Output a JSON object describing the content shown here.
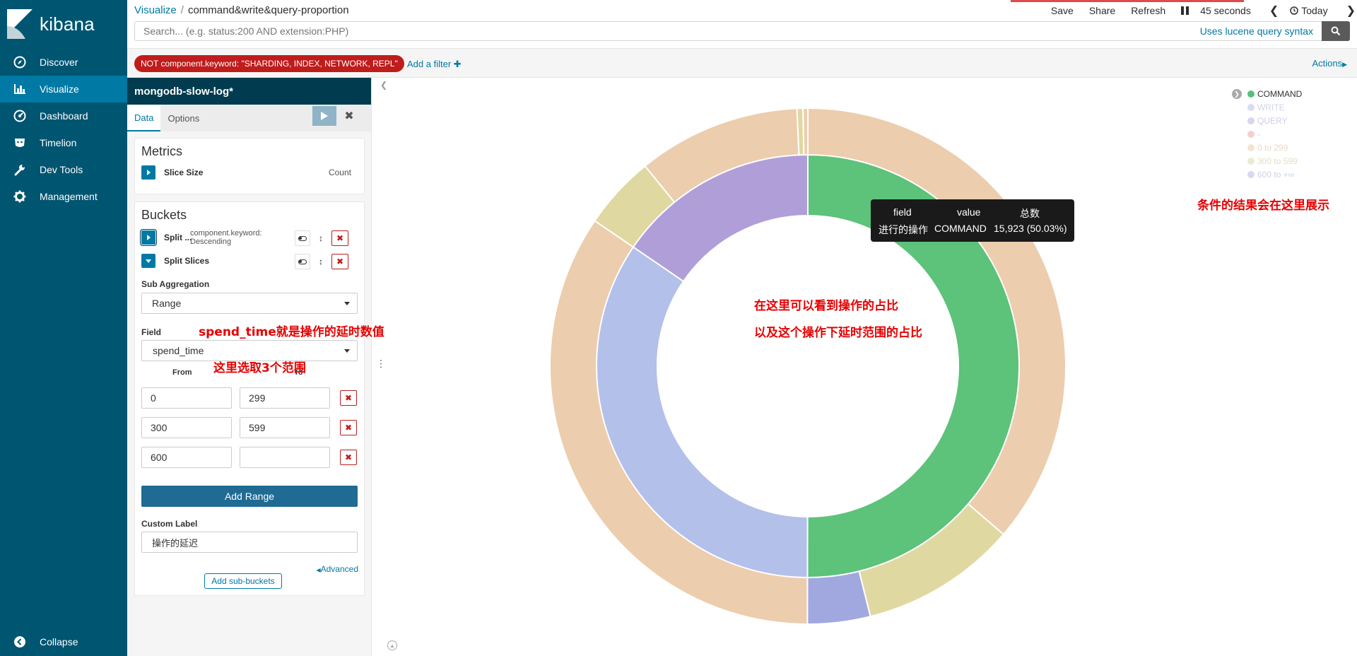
{
  "app": {
    "name": "kibana"
  },
  "sidebar": {
    "items": [
      {
        "label": "Discover",
        "icon": "compass-icon"
      },
      {
        "label": "Visualize",
        "icon": "bar-chart-icon",
        "active": true
      },
      {
        "label": "Dashboard",
        "icon": "dashboard-icon"
      },
      {
        "label": "Timelion",
        "icon": "timelion-icon"
      },
      {
        "label": "Dev Tools",
        "icon": "wrench-icon"
      },
      {
        "label": "Management",
        "icon": "gear-icon"
      }
    ],
    "collapse_label": "Collapse"
  },
  "breadcrumb": {
    "root": "Visualize",
    "separator": "/",
    "current": "command&write&query-proportion"
  },
  "top_actions": {
    "save": "Save",
    "share": "Share",
    "refresh": "Refresh",
    "interval": "45 seconds",
    "time": "Today"
  },
  "search": {
    "placeholder": "Search... (e.g. status:200 AND extension:PHP)",
    "syntax_link": "Uses lucene query syntax"
  },
  "filterbar": {
    "filter_pill": "NOT component.keyword: \"SHARDING, INDEX, NETWORK, REPL\"",
    "add_filter": "Add a filter",
    "actions": "Actions"
  },
  "editor": {
    "index_title": "mongodb-slow-log*",
    "tabs": [
      "Data",
      "Options"
    ],
    "metrics": {
      "title": "Metrics",
      "item_label": "Slice Size",
      "item_value": "Count"
    },
    "buckets": {
      "title": "Buckets",
      "split1_label": "Split ...",
      "split1_desc_line1": "component.keyword:",
      "split1_desc_line2": "Descending",
      "split2_label": "Split Slices",
      "sub_agg_label": "Sub Aggregation",
      "sub_agg_value": "Range",
      "field_label": "Field",
      "field_value": "spend_time",
      "from_label": "From",
      "to_label": "To",
      "ranges": [
        {
          "from": "0",
          "to": "299"
        },
        {
          "from": "300",
          "to": "599"
        },
        {
          "from": "600",
          "to": ""
        }
      ],
      "add_range": "Add Range",
      "custom_label_label": "Custom Label",
      "custom_label_value": "操作的延迟",
      "advanced": "Advanced",
      "add_sub_buckets": "Add sub-buckets"
    }
  },
  "annotations": {
    "field_note": "spend_time就是操作的延时数值",
    "range_note": "这里选取3个范围",
    "chart_note1": "在这里可以看到操作的占比",
    "chart_note2": "以及这个操作下延时范围的占比",
    "legend_note": "条件的结果会在这里展示"
  },
  "tooltip": {
    "headers": [
      "field",
      "value",
      "总数"
    ],
    "row": [
      "进行的操作",
      "COMMAND",
      "15,923 (50.03%)"
    ]
  },
  "legend": {
    "items": [
      {
        "label": "COMMAND",
        "color": "#57c17b"
      },
      {
        "label": "WRITE",
        "color": "#d7ddf3"
      },
      {
        "label": "QUERY",
        "color": "#dcd3ee"
      },
      {
        "label": "-",
        "color": "#f3d0d0"
      },
      {
        "label": "0 to 299",
        "color": "#f5e3d2"
      },
      {
        "label": "300 to 599",
        "color": "#ecebcf"
      },
      {
        "label": "600 to +∞",
        "color": "#d6d9f2"
      }
    ]
  },
  "chart_data": {
    "type": "pie",
    "title": "",
    "inner_ring": [
      {
        "label": "COMMAND",
        "value": 50.03,
        "color": "#5dc27a"
      },
      {
        "label": "WRITE",
        "value": 34.5,
        "color": "#b3c0ea"
      },
      {
        "label": "QUERY",
        "value": 15.47,
        "color": "#b09ed9"
      }
    ],
    "outer_ring": [
      {
        "parent": "COMMAND",
        "label": "0 to 299",
        "value": 36.3,
        "color": "#eccdad"
      },
      {
        "parent": "COMMAND",
        "label": "300 to 599",
        "value": 9.8,
        "color": "#e0d8a1"
      },
      {
        "parent": "COMMAND",
        "label": "600 to +∞",
        "value": 3.93,
        "color": "#a1a8e0"
      },
      {
        "parent": "WRITE",
        "label": "0 to 299",
        "value": 34.5,
        "color": "#eccdad"
      },
      {
        "parent": "QUERY",
        "label": "300 to 599",
        "value": 4.6,
        "color": "#e0d8a1"
      },
      {
        "parent": "QUERY",
        "label": "0 to 299",
        "value": 10.2,
        "color": "#eccdad"
      },
      {
        "parent": "QUERY",
        "label": "300 to 599",
        "value": 0.37,
        "color": "#e0d8a1"
      },
      {
        "parent": "QUERY",
        "label": "600 to +∞",
        "value": 0.3,
        "color": "#eccdad"
      }
    ]
  }
}
